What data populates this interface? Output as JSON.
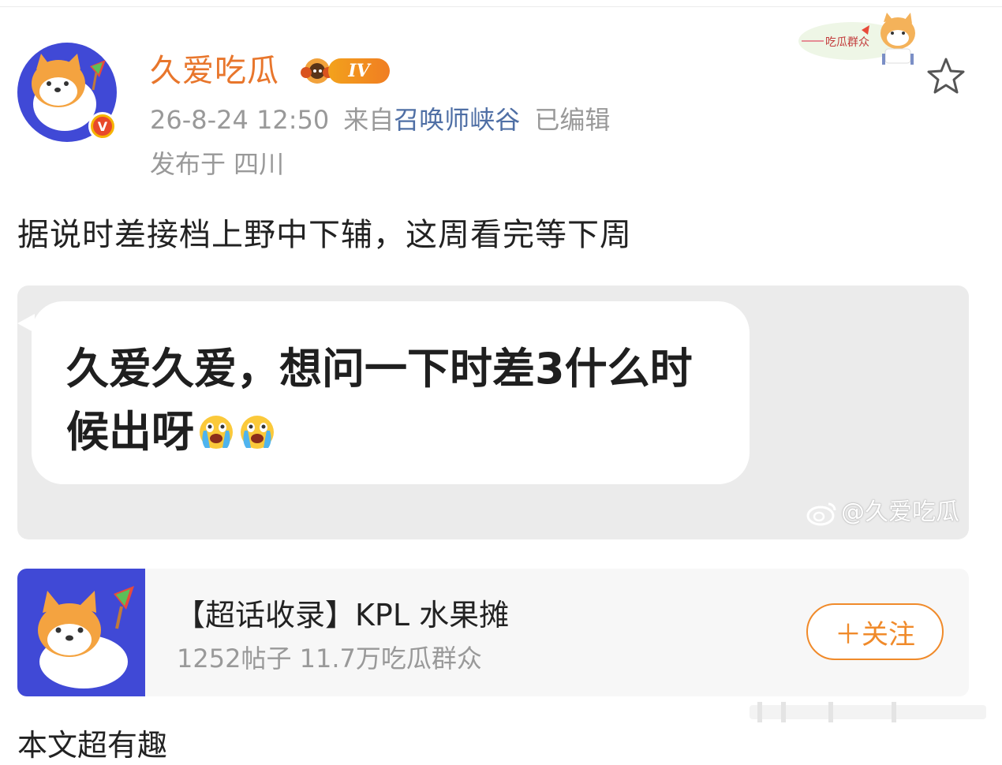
{
  "post": {
    "username": "久爱吃瓜",
    "level_label": "IV",
    "date": "26-8-24 12:50",
    "source_prefix": "来自",
    "source_name": "召唤师峡谷",
    "edited": "已编辑",
    "location": "发布于 四川",
    "text": "据说时差接档上野中下辅，这周看完等下周"
  },
  "image": {
    "bubble_text": "久爱久爱，想问一下时差3什么时候出呀",
    "emoji_count": 2,
    "watermark": "@久爱吃瓜"
  },
  "header_watermark": {
    "text": "吃瓜群众"
  },
  "topic": {
    "title": "【超话收录】KPL 水果摊",
    "subtitle": "1252帖子 11.7万吃瓜群众",
    "follow_label": "＋关注"
  },
  "footer": {
    "partial_text": "本文超有趣"
  },
  "colors": {
    "username": "#e8762c",
    "source_link": "#4f6fa5",
    "follow": "#f08a2a",
    "avatar_bg": "#4049d6",
    "card_bg": "#ebebeb"
  },
  "icons": [
    "verified-badge-icon",
    "level-badge-icon",
    "star-icon",
    "crying-emoji-icon",
    "weibo-logo-icon"
  ]
}
